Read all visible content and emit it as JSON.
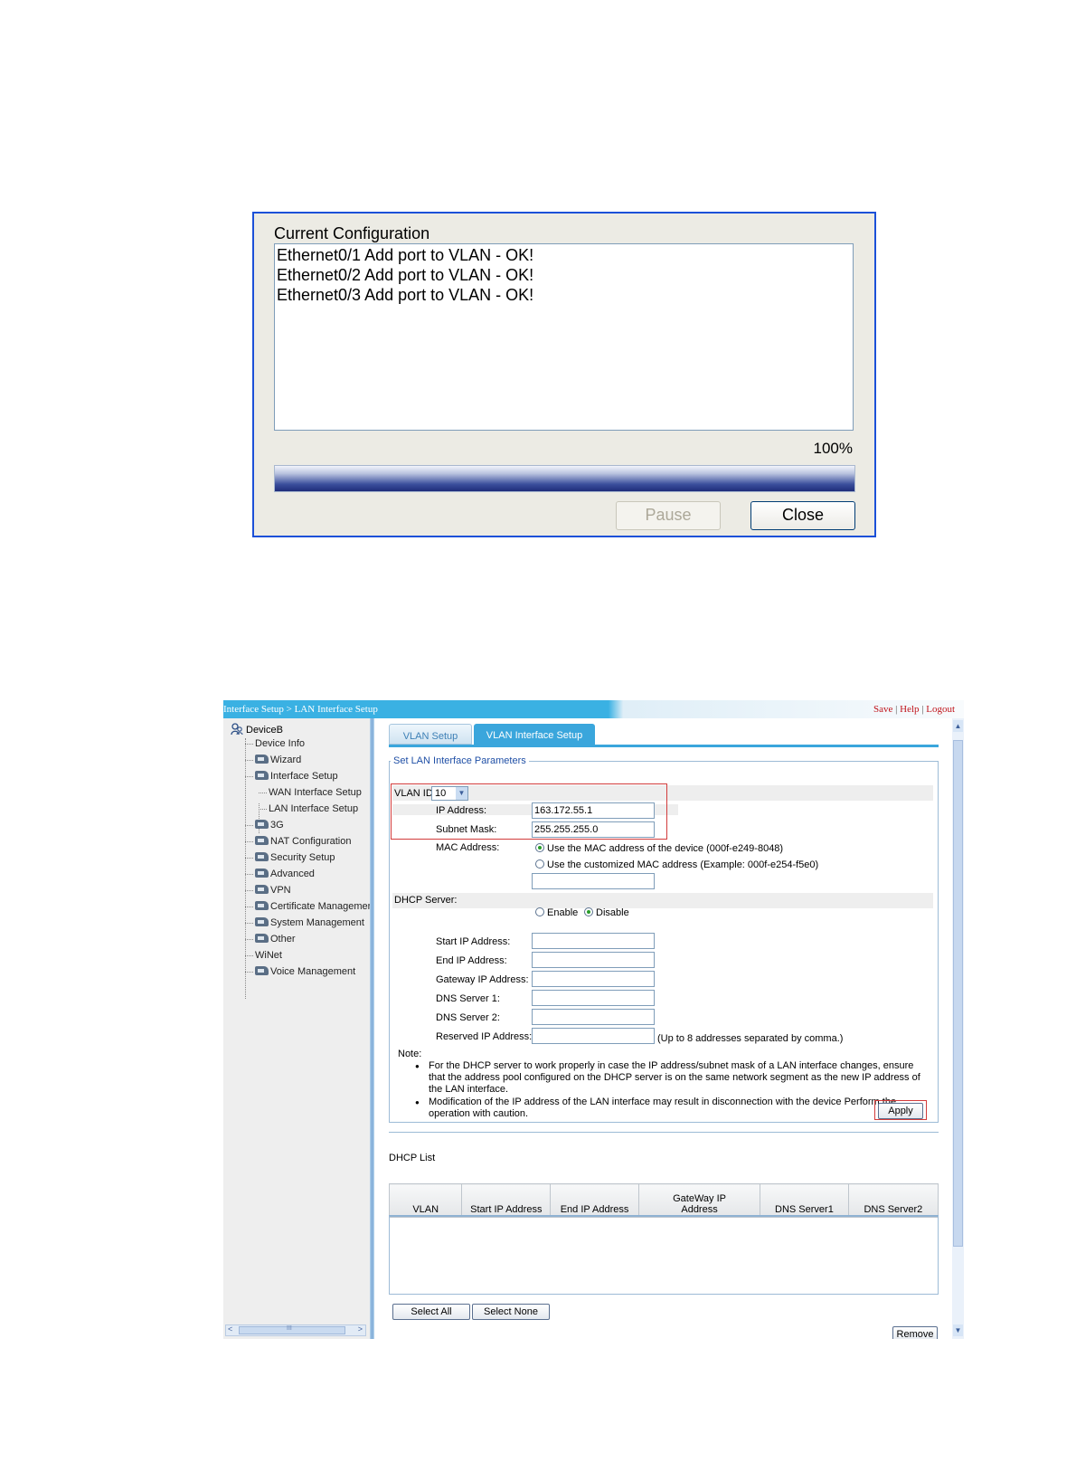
{
  "dialog": {
    "title": "Current Configuration",
    "log_lines": [
      "Ethernet0/1 Add port to VLAN - OK!",
      "Ethernet0/2 Add port to VLAN - OK!",
      "Ethernet0/3 Add port to VLAN - OK!"
    ],
    "progress_label": "100%",
    "progress_fraction": 1.0,
    "pause_label": "Pause",
    "close_label": "Close"
  },
  "web": {
    "breadcrumb": "Interface Setup > LAN Interface Setup",
    "top_links": {
      "save": "Save",
      "help": "Help",
      "logout": "Logout",
      "sep": "|"
    },
    "nav": {
      "root": "DeviceB",
      "items": [
        "Device Info",
        "Wizard",
        "Interface Setup",
        "WAN Interface Setup",
        "LAN Interface Setup",
        "3G",
        "NAT Configuration",
        "Security Setup",
        "Advanced",
        "VPN",
        "Certificate Managemen",
        "System Management",
        "Other",
        "WiNet",
        "Voice Management"
      ]
    },
    "tabs": [
      "VLAN Setup",
      "VLAN Interface Setup"
    ],
    "form": {
      "legend": "Set LAN Interface Parameters",
      "vlan_id_label": "VLAN ID",
      "vlan_id_value": "10",
      "ip_label": "IP Address:",
      "ip_value": "163.172.55.1",
      "mask_label": "Subnet Mask:",
      "mask_value": "255.255.255.0",
      "mac_label": "MAC Address:",
      "mac_opt1": "Use the MAC address of the device (000f-e249-8048)",
      "mac_opt2": "Use the customized MAC address (Example: 000f-e254-f5e0)",
      "dhcp_label": "DHCP Server:",
      "enable_label": "Enable",
      "disable_label": "Disable",
      "start_ip_label": "Start IP Address:",
      "end_ip_label": "End IP Address:",
      "gateway_label": "Gateway IP Address:",
      "dns1_label": "DNS Server 1:",
      "dns2_label": "DNS Server 2:",
      "reserved_label": "Reserved IP Address:",
      "reserved_hint": "(Up to 8 addresses separated by comma.)",
      "note_label": "Note:",
      "notes": [
        "For the DHCP server to work properly in case the IP address/subnet mask of a LAN interface changes, ensure that the address pool configured on the DHCP server is on the same network segment as the new IP address of the LAN interface.",
        "Modification of the IP address of the LAN interface may result in disconnection with the device Perform the operation with caution."
      ],
      "apply_label": "Apply"
    },
    "dhcp_list": {
      "title": "DHCP List",
      "columns": [
        "VLAN",
        "Start IP Address",
        "End IP Address",
        "GateWay IP Address",
        "DNS Server1",
        "DNS Server2"
      ],
      "select_all": "Select All",
      "select_none": "Select None",
      "remove": "Remove"
    },
    "scroll_glyphs": {
      "left": "<",
      "right": ">",
      "grip": "III",
      "up": "▲",
      "down": "▼",
      "combo": "▼"
    }
  }
}
